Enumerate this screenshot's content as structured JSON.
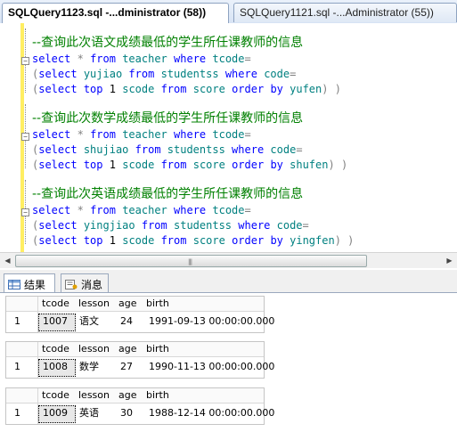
{
  "tabs": [
    {
      "label": "SQLQuery1123.sql -...dministrator (58))",
      "active": true
    },
    {
      "label": "SQLQuery1121.sql -...Administrator (55))",
      "active": false
    }
  ],
  "editor": {
    "blocks": [
      {
        "comment": "--查询此次语文成绩最低的学生所任课教师的信息",
        "line1": {
          "select": "select",
          "star": "*",
          "from": "from",
          "table": "teacher",
          "where": "where",
          "col": "tcode",
          "eq": "="
        },
        "line2": {
          "open": "(",
          "select": "select",
          "col": "yujiao",
          "from": "from",
          "table": "studentss",
          "where": "where",
          "cond": "code",
          "eq": "="
        },
        "line3": {
          "open": "(",
          "select": "select",
          "top": "top",
          "n": "1",
          "col": "scode",
          "from": "from",
          "table": "score",
          "order": "order",
          "by": "by",
          "sort": "yufen",
          "close": ")",
          "close2": ")"
        }
      },
      {
        "comment": "--查询此次数学成绩最低的学生所任课教师的信息",
        "line1": {
          "select": "select",
          "star": "*",
          "from": "from",
          "table": "teacher",
          "where": "where",
          "col": "tcode",
          "eq": "="
        },
        "line2": {
          "open": "(",
          "select": "select",
          "col": "shujiao",
          "from": "from",
          "table": "studentss",
          "where": "where",
          "cond": "code",
          "eq": "="
        },
        "line3": {
          "open": "(",
          "select": "select",
          "top": "top",
          "n": "1",
          "col": "scode",
          "from": "from",
          "table": "score",
          "order": "order",
          "by": "by",
          "sort": "shufen",
          "close": ")",
          "close2": ")"
        }
      },
      {
        "comment": "--查询此次英语成绩最低的学生所任课教师的信息",
        "line1": {
          "select": "select",
          "star": "*",
          "from": "from",
          "table": "teacher",
          "where": "where",
          "col": "tcode",
          "eq": "="
        },
        "line2": {
          "open": "(",
          "select": "select",
          "col": "yingjiao",
          "from": "from",
          "table": "studentss",
          "where": "where",
          "cond": "code",
          "eq": "="
        },
        "line3": {
          "open": "(",
          "select": "select",
          "top": "top",
          "n": "1",
          "col": "scode",
          "from": "from",
          "table": "score",
          "order": "order",
          "by": "by",
          "sort": "yingfen",
          "close": ")",
          "close2": ")"
        }
      }
    ]
  },
  "scrollbar": {
    "left_arrow": "◀",
    "right_arrow": "▶",
    "grip": "|||"
  },
  "result_tabs": {
    "results": "结果",
    "messages": "消息"
  },
  "grids": [
    {
      "columns": [
        "tcode",
        "lesson",
        "age",
        "birth"
      ],
      "row_number": "1",
      "row": [
        "1007",
        "语文",
        "24",
        "1991-09-13 00:00:00.000"
      ]
    },
    {
      "columns": [
        "tcode",
        "lesson",
        "age",
        "birth"
      ],
      "row_number": "1",
      "row": [
        "1008",
        "数学",
        "27",
        "1990-11-13 00:00:00.000"
      ]
    },
    {
      "columns": [
        "tcode",
        "lesson",
        "age",
        "birth"
      ],
      "row_number": "1",
      "row": [
        "1009",
        "英语",
        "30",
        "1988-12-14 00:00:00.000"
      ]
    }
  ],
  "colors": {
    "keyword": "#0000ff",
    "comment": "#008000",
    "function": "#ff00ff",
    "identifier": "#008080",
    "operator": "#808080",
    "change_bar": "#ffee62"
  }
}
